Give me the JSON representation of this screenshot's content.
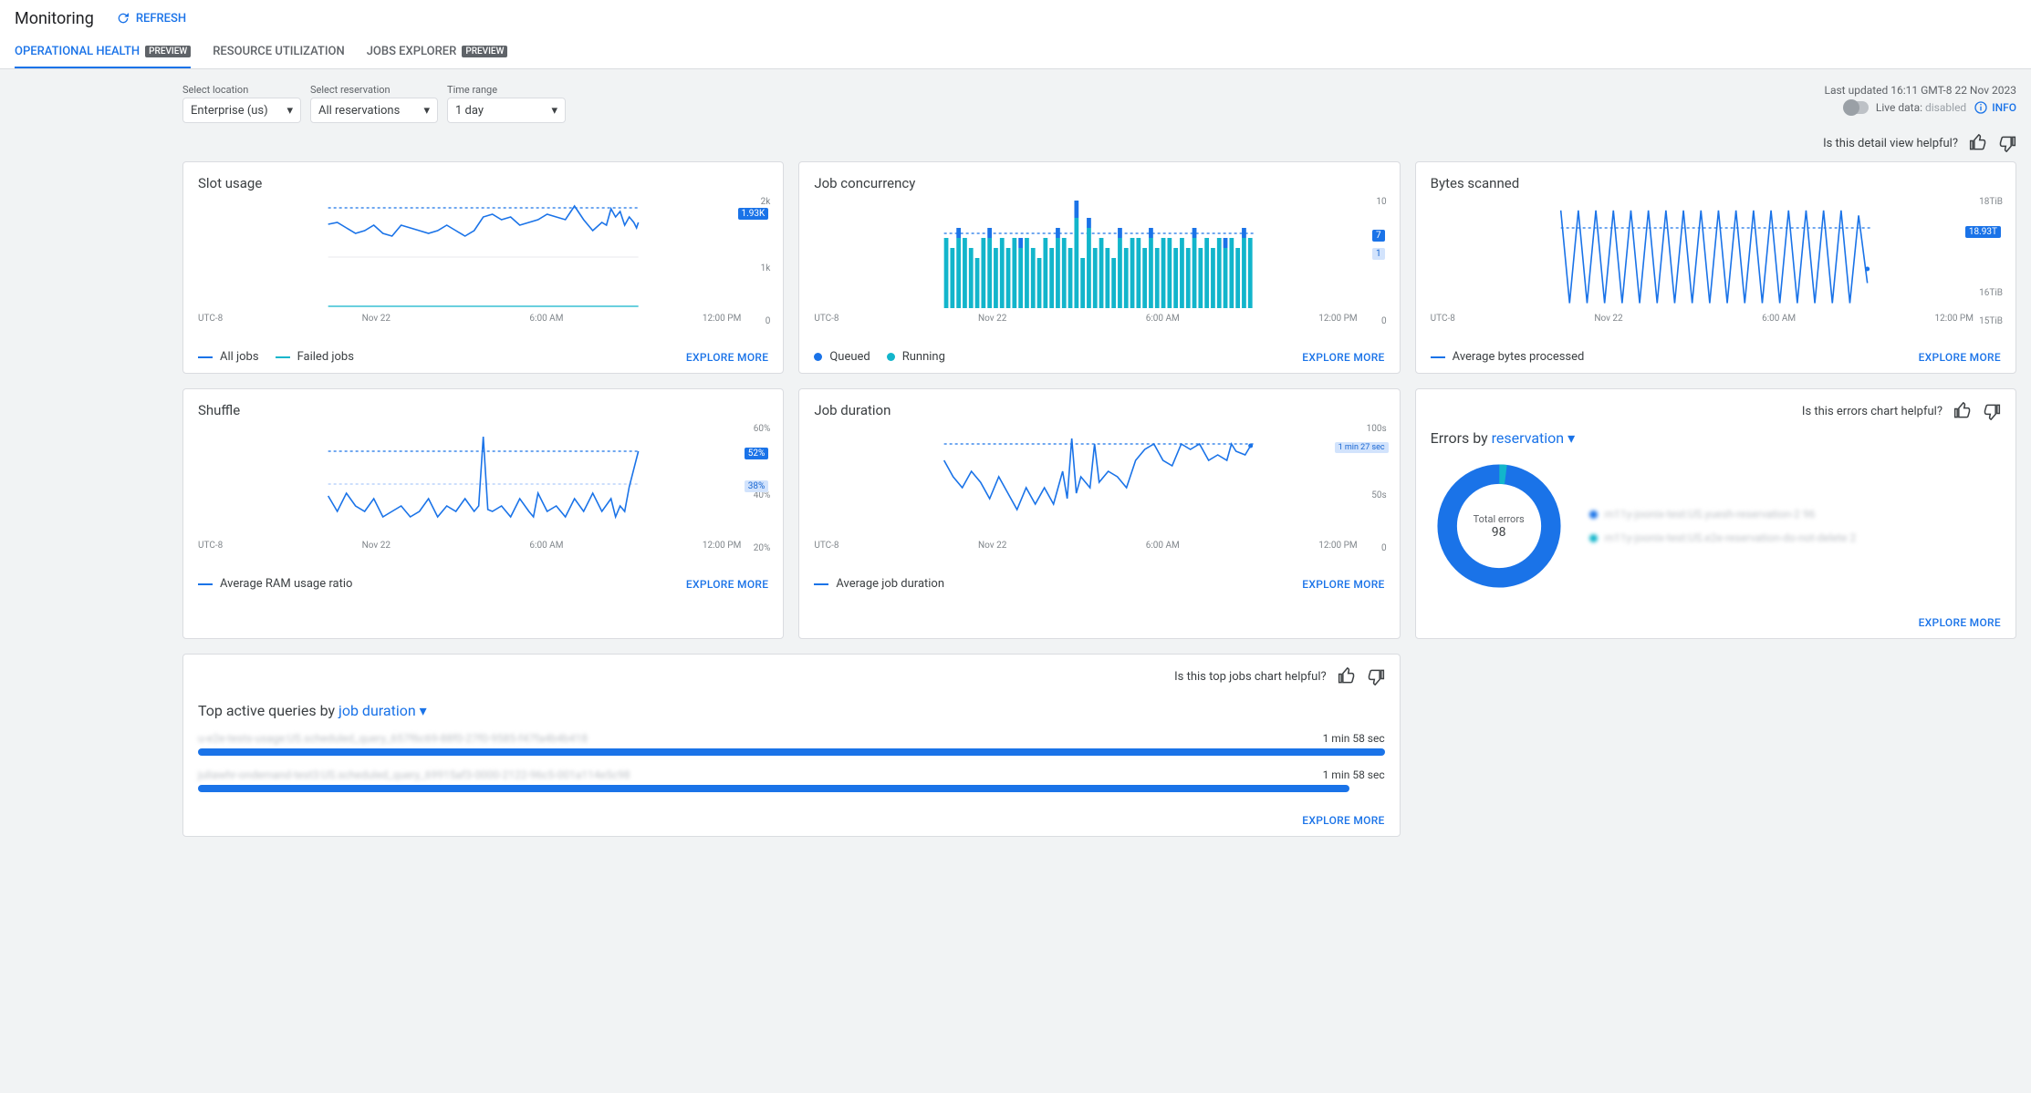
{
  "header": {
    "title": "Monitoring",
    "refresh": "REFRESH"
  },
  "tabs": [
    {
      "label": "OPERATIONAL HEALTH",
      "badge": "PREVIEW",
      "active": true
    },
    {
      "label": "RESOURCE UTILIZATION",
      "badge": "",
      "active": false
    },
    {
      "label": "JOBS EXPLORER",
      "badge": "PREVIEW",
      "active": false
    }
  ],
  "filters": {
    "location_label": "Select location",
    "location_value": "Enterprise (us)",
    "reservation_label": "Select reservation",
    "reservation_value": "All reservations",
    "time_label": "Time range",
    "time_value": "1 day"
  },
  "right": {
    "last_updated": "Last updated 16:11 GMT-8 22 Nov 2023",
    "live_label": "Live data:",
    "live_state": "disabled",
    "info": "INFO"
  },
  "feedback": {
    "detail_q": "Is this detail view helpful?",
    "errors_q": "Is this errors chart helpful?",
    "topjobs_q": "Is this top jobs chart helpful?"
  },
  "xaxis": [
    "UTC-8",
    "Nov 22",
    "6:00 AM",
    "12:00 PM"
  ],
  "cards": {
    "slot": {
      "title": "Slot usage",
      "yticks": [
        "2k",
        "1k",
        "0"
      ],
      "badge": "1.93K",
      "legend": [
        {
          "t": "line_blue",
          "label": "All jobs"
        },
        {
          "t": "line_teal",
          "label": "Failed jobs"
        }
      ],
      "explore": "EXPLORE MORE"
    },
    "conc": {
      "title": "Job concurrency",
      "yticks": [
        "10",
        "",
        "0"
      ],
      "badge_running": "7",
      "badge_queued": "1",
      "legend": [
        {
          "t": "dot_blue",
          "label": "Queued"
        },
        {
          "t": "dot_teal",
          "label": "Running"
        }
      ],
      "explore": "EXPLORE MORE"
    },
    "bytes": {
      "title": "Bytes scanned",
      "yticks": [
        "18TiB",
        "16TiB",
        "15TiB"
      ],
      "badge": "18.93T",
      "legend": [
        {
          "t": "line_blue",
          "label": "Average bytes processed"
        }
      ],
      "explore": "EXPLORE MORE"
    },
    "shuffle": {
      "title": "Shuffle",
      "yticks": [
        "60%",
        "40%",
        "20%"
      ],
      "badge_main": "52%",
      "badge_light": "38%",
      "legend": [
        {
          "t": "line_blue",
          "label": "Average RAM usage ratio"
        }
      ],
      "explore": "EXPLORE MORE"
    },
    "jobdur": {
      "title": "Job duration",
      "yticks": [
        "100s",
        "50s",
        "0"
      ],
      "badge": "1 min 27 sec",
      "legend": [
        {
          "t": "line_blue",
          "label": "Average job duration"
        }
      ],
      "explore": "EXPLORE MORE"
    },
    "errors": {
      "title_pre": "Errors by ",
      "title_link": "reservation",
      "center_label": "Total errors",
      "center_value": "98",
      "items": [
        {
          "color": "#1a73e8",
          "label": "m11y-joonix-test:US.yuesh-reservation-2 96"
        },
        {
          "color": "#12b5cb",
          "label": "m11y-joonix-test:US.e2e-reservation-do-not-delete 2"
        }
      ],
      "explore": "EXPLORE MORE"
    },
    "topq": {
      "title_pre": "Top active queries by ",
      "title_link": "job duration",
      "rows": [
        {
          "name": "u-e2e-tests-usage:US.scheduled_query_657f6c69-88f0-27f0-9585-f47fa4b4b418",
          "dur": "1 min 58 sec",
          "pct": 100
        },
        {
          "name": "juliawhr-ondemand-test3:US.scheduled_query_69915af3-0000-2122-96c5-001a114e5c98",
          "dur": "1 min 58 sec",
          "pct": 97
        }
      ],
      "explore": "EXPLORE MORE"
    }
  },
  "chart_data": [
    {
      "type": "line",
      "title": "Slot usage",
      "ylabel": "",
      "ylim": [
        0,
        2000
      ],
      "xticks": [
        "UTC-8",
        "Nov 22",
        "6:00 AM",
        "12:00 PM"
      ],
      "series": [
        {
          "name": "All jobs",
          "values": [
            1500,
            1550,
            1450,
            1350,
            1400,
            1500,
            1350,
            1300,
            1500,
            1450,
            1400,
            1350,
            1400,
            1500,
            1400,
            1300,
            1400,
            1650,
            1700,
            1600,
            1650,
            1500,
            1550,
            1600,
            1700,
            1650,
            1600,
            1900,
            1600,
            1400,
            1550,
            1500,
            1800,
            1650,
            1750,
            1500,
            1650,
            1550,
            1450,
            1550
          ]
        },
        {
          "name": "Failed jobs",
          "values": [
            30,
            25,
            30,
            35,
            28,
            30,
            32,
            30,
            28,
            30,
            35,
            30,
            28,
            30,
            32,
            30,
            28,
            30,
            35,
            30,
            28,
            30,
            32,
            30,
            28,
            30,
            35,
            30,
            28,
            30,
            32,
            30,
            28,
            30,
            35,
            30,
            28,
            30,
            35,
            30
          ]
        }
      ],
      "last_value_label": "1.93K"
    },
    {
      "type": "bar",
      "title": "Job concurrency",
      "ylabel": "",
      "ylim": [
        0,
        10
      ],
      "xticks": [
        "UTC-8",
        "Nov 22",
        "6:00 AM",
        "12:00 PM"
      ],
      "series": [
        {
          "name": "Running",
          "values": [
            7,
            6,
            7,
            7,
            6,
            5,
            7,
            7,
            6,
            7,
            6,
            7,
            6,
            7,
            6,
            5,
            7,
            6,
            7,
            7,
            6,
            9,
            5,
            8,
            6,
            7,
            6,
            5,
            7,
            6,
            7,
            7,
            6,
            7,
            6,
            7,
            7,
            6,
            7,
            6,
            7,
            6,
            7,
            6,
            7,
            6,
            7,
            6,
            7,
            7
          ]
        },
        {
          "name": "Queued",
          "values": [
            0,
            0,
            1,
            0,
            0,
            0,
            0,
            1,
            0,
            0,
            0,
            0,
            1,
            0,
            0,
            0,
            0,
            0,
            1,
            0,
            0,
            2,
            0,
            1,
            0,
            0,
            0,
            0,
            1,
            0,
            0,
            0,
            0,
            1,
            0,
            0,
            0,
            0,
            0,
            0,
            1,
            0,
            0,
            0,
            0,
            1,
            0,
            0,
            1,
            0
          ]
        }
      ],
      "last_running": 7,
      "last_queued": 1
    },
    {
      "type": "line",
      "title": "Bytes scanned",
      "ylabel": "",
      "ylim": [
        15,
        18
      ],
      "yunit": "TiB",
      "xticks": [
        "UTC-8",
        "Nov 22",
        "6:00 AM",
        "12:00 PM"
      ],
      "series": [
        {
          "name": "Average bytes processed",
          "values": [
            18.9,
            15.2,
            18.9,
            15.2,
            18.9,
            15.2,
            18.9,
            15.2,
            18.9,
            15.2,
            18.9,
            15.2,
            18.9,
            15.2,
            18.9,
            15.2,
            18.9,
            15.2,
            18.9,
            15.2,
            18.9,
            15.2,
            18.9,
            15.2,
            18.9,
            15.2,
            18.9,
            15.2,
            18.9,
            15.2,
            18.9,
            15.2,
            18.9,
            15.2,
            18.7,
            16.0
          ]
        }
      ],
      "last_value_label": "18.93T"
    },
    {
      "type": "line",
      "title": "Shuffle",
      "ylabel": "",
      "ylim": [
        20,
        60
      ],
      "yunit": "%",
      "xticks": [
        "UTC-8",
        "Nov 22",
        "6:00 AM",
        "12:00 PM"
      ],
      "series": [
        {
          "name": "Average RAM usage ratio",
          "values": [
            35,
            30,
            36,
            32,
            30,
            34,
            28,
            30,
            32,
            28,
            30,
            34,
            28,
            32,
            30,
            34,
            30,
            32,
            28,
            58,
            30,
            32,
            28,
            34,
            30,
            28,
            36,
            30,
            32,
            28,
            34,
            30,
            36,
            30,
            34,
            28,
            32,
            30,
            38,
            52
          ]
        }
      ],
      "last_value_label": "52%",
      "secondary_label": "38%"
    },
    {
      "type": "line",
      "title": "Job duration",
      "ylabel": "",
      "ylim": [
        0,
        100
      ],
      "yunit": "s",
      "xticks": [
        "UTC-8",
        "Nov 22",
        "6:00 AM",
        "12:00 PM"
      ],
      "series": [
        {
          "name": "Average job duration",
          "values": [
            70,
            55,
            45,
            60,
            50,
            35,
            55,
            40,
            25,
            45,
            30,
            45,
            30,
            60,
            35,
            95,
            40,
            55,
            45,
            90,
            50,
            60,
            55,
            45,
            70,
            80,
            85,
            70,
            65,
            90,
            80,
            85,
            70,
            75,
            70,
            85,
            78,
            76,
            74,
            87
          ]
        }
      ],
      "last_value_label": "1 min 27 sec"
    },
    {
      "type": "pie",
      "title": "Errors by reservation",
      "series": [
        {
          "name": "yuesh-reservation-2",
          "value": 96
        },
        {
          "name": "e2e-reservation-do-not-delete",
          "value": 2
        }
      ],
      "total_label": "Total errors",
      "total": 98
    }
  ]
}
